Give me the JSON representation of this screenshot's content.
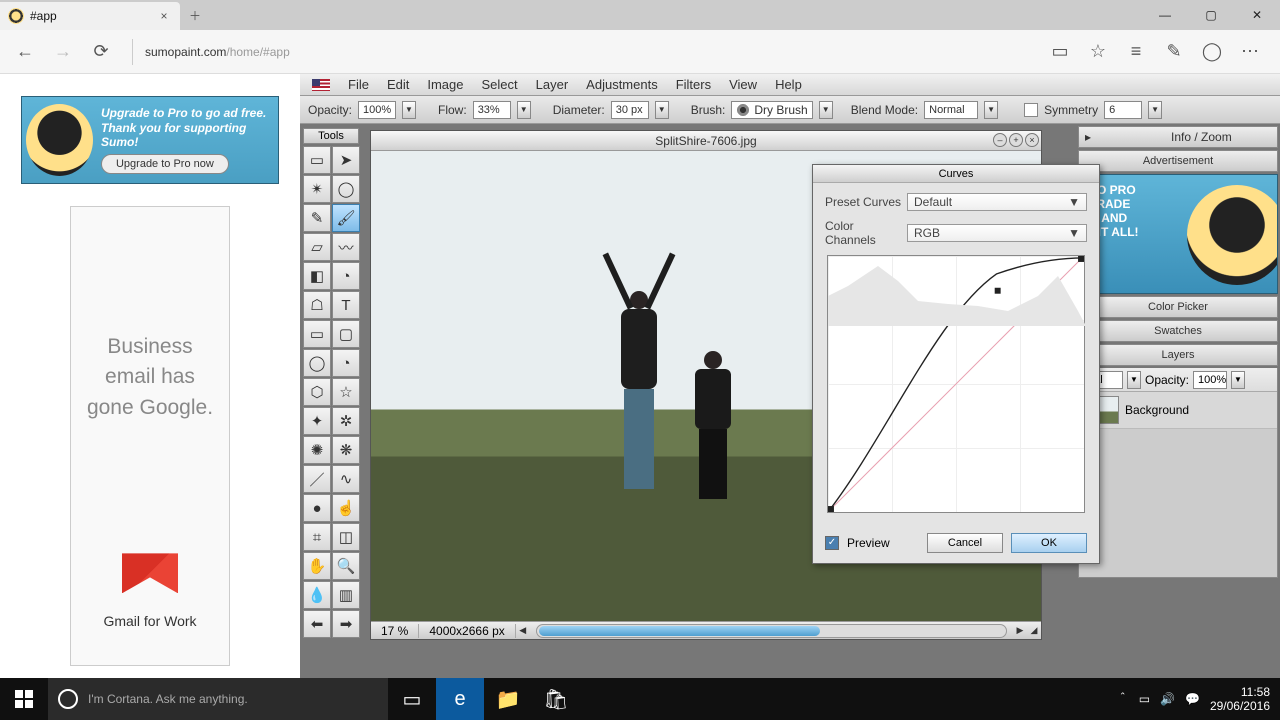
{
  "browser": {
    "tab_title": "#app",
    "url_host": "sumopaint.com",
    "url_path": "/home/#app"
  },
  "left_ads": {
    "pro_line1": "Upgrade to Pro to go ad free.",
    "pro_line2": "Thank you for supporting Sumo!",
    "pro_button": "Upgrade to Pro now",
    "google_headline": "Business email has gone Google.",
    "google_sub": "Gmail for Work"
  },
  "menu": [
    "File",
    "Edit",
    "Image",
    "Select",
    "Layer",
    "Adjustments",
    "Filters",
    "View",
    "Help"
  ],
  "optionbar": {
    "opacity_label": "Opacity:",
    "opacity_value": "100%",
    "flow_label": "Flow:",
    "flow_value": "33%",
    "diameter_label": "Diameter:",
    "diameter_value": "30 px",
    "brush_label": "Brush:",
    "brush_name": "Dry Brush",
    "blend_label": "Blend Mode:",
    "blend_value": "Normal",
    "symmetry_label": "Symmetry",
    "symmetry_value": "6"
  },
  "tools_title": "Tools",
  "canvas": {
    "filename": "SplitShire-7606.jpg",
    "zoom": "17 %",
    "dimensions": "4000x2666 px"
  },
  "right_panels": {
    "info_zoom": "Info / Zoom",
    "advertisement": "Advertisement",
    "mo_pro_line1": "MO PRO",
    "mo_pro_line2": "GRADE",
    "mo_pro_line3": "W AND",
    "mo_pro_line4": "T IT ALL!",
    "color_picker": "Color Picker",
    "swatches": "Swatches",
    "layers": "Layers",
    "layer_mode": "nal",
    "layer_opacity_label": "Opacity:",
    "layer_opacity_value": "100%",
    "layer_name": "Background"
  },
  "curves": {
    "title": "Curves",
    "preset_label": "Preset Curves",
    "preset_value": "Default",
    "channel_label": "Color Channels",
    "channel_value": "RGB",
    "preview_label": "Preview",
    "cancel": "Cancel",
    "ok": "OK"
  },
  "taskbar": {
    "search_placeholder": "I'm Cortana. Ask me anything.",
    "time": "11:58",
    "date": "29/06/2016"
  }
}
